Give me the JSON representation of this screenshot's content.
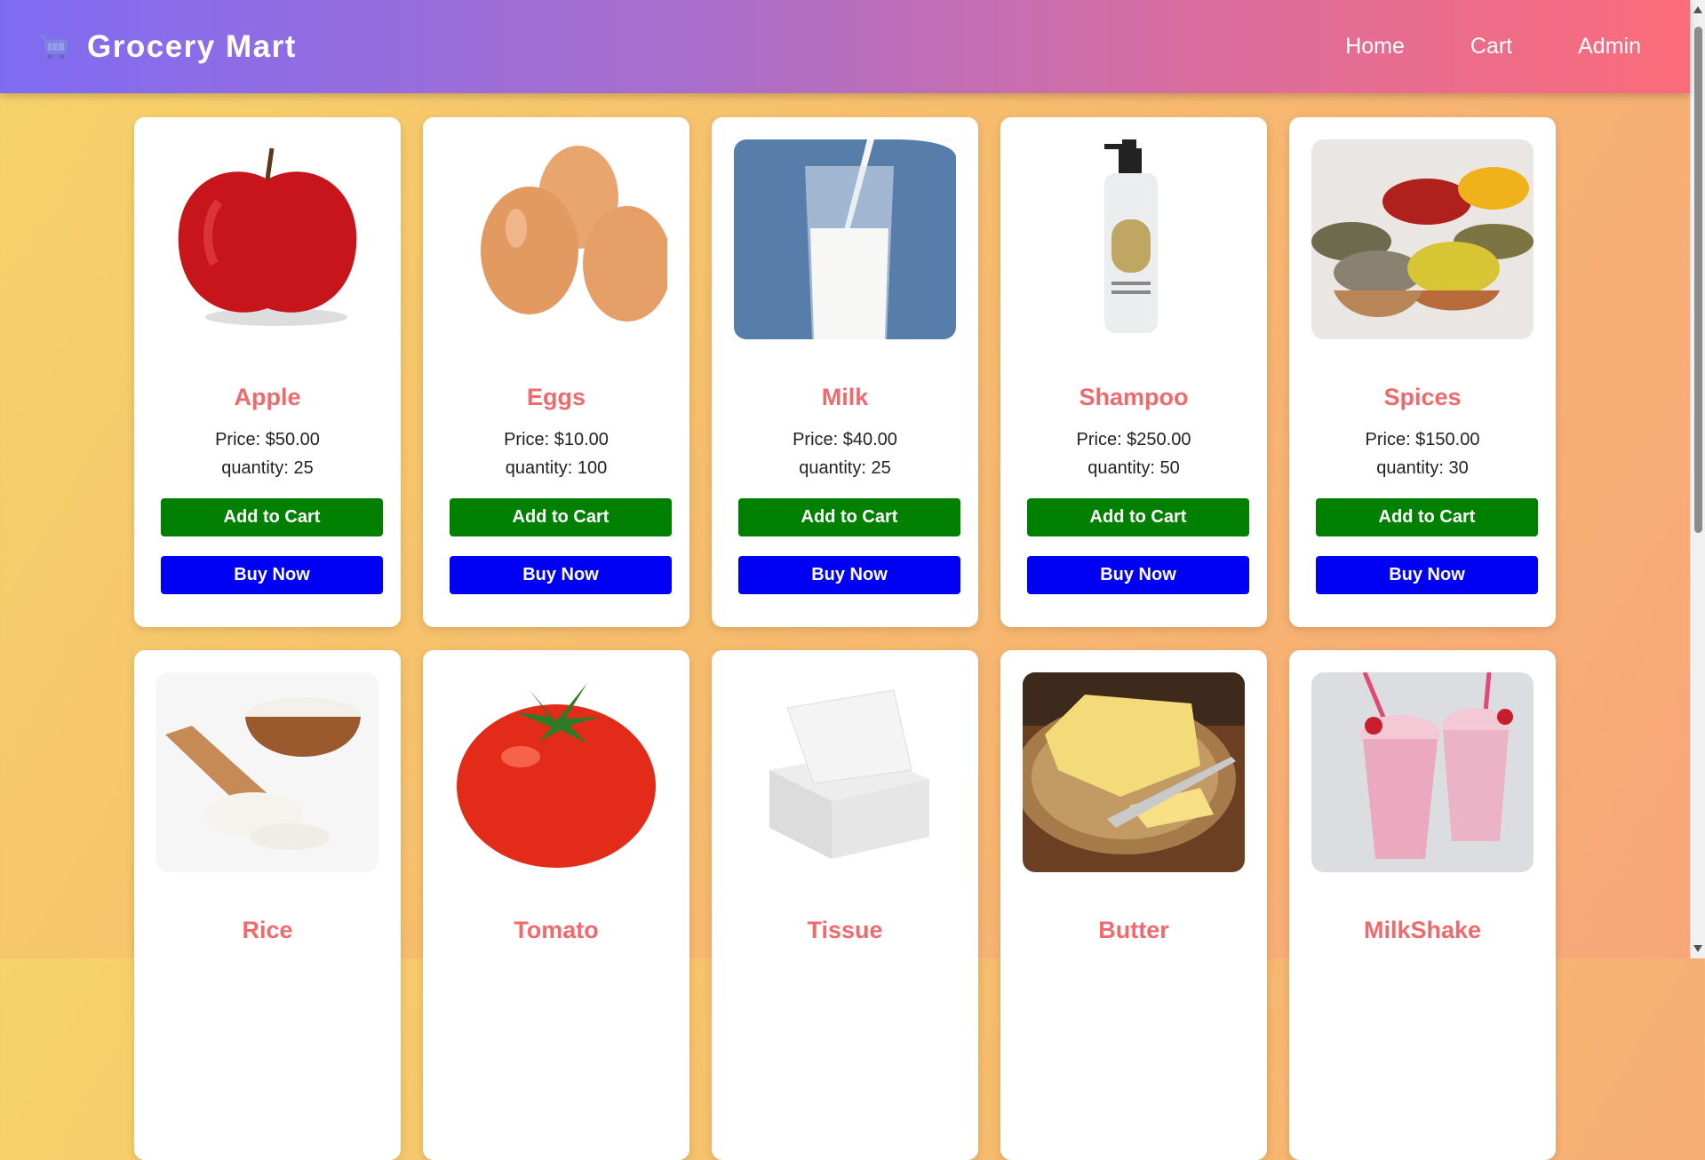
{
  "brand": {
    "title": "Grocery Mart",
    "icon": "shopping-cart-icon"
  },
  "nav": {
    "home": "Home",
    "cart": "Cart",
    "admin": "Admin"
  },
  "buttons": {
    "add_to_cart": "Add to Cart",
    "buy_now": "Buy Now"
  },
  "products": [
    {
      "name": "Apple",
      "price": "Price: $50.00",
      "quantity": "quantity: 25",
      "image": "apple"
    },
    {
      "name": "Eggs",
      "price": "Price: $10.00",
      "quantity": "quantity: 100",
      "image": "eggs"
    },
    {
      "name": "Milk",
      "price": "Price: $40.00",
      "quantity": "quantity: 25",
      "image": "milk-glass"
    },
    {
      "name": "Shampoo",
      "price": "Price: $250.00",
      "quantity": "quantity: 50",
      "image": "shampoo-bottle"
    },
    {
      "name": "Spices",
      "price": "Price: $150.00",
      "quantity": "quantity: 30",
      "image": "spice-bowls"
    },
    {
      "name": "Rice",
      "image": "rice-bowl"
    },
    {
      "name": "Tomato",
      "image": "tomato"
    },
    {
      "name": "Tissue",
      "image": "tissue-box"
    },
    {
      "name": "Butter",
      "image": "butter-plate"
    },
    {
      "name": "MilkShake",
      "image": "milkshake-glasses"
    }
  ],
  "colors": {
    "product_name": "#f06a6d",
    "add_button": "#008000",
    "buy_button": "#0000f5"
  }
}
